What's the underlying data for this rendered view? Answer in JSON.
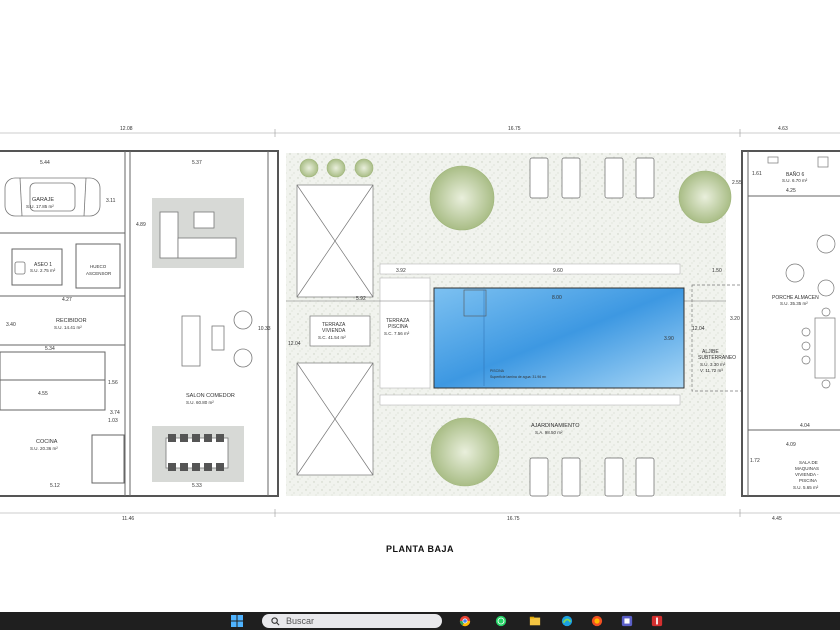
{
  "plan": {
    "title": "PLANTA BAJA",
    "dims_top": [
      "12.08",
      "16.75",
      "4.63"
    ],
    "dims_bottom": [
      "11.46",
      "16.75",
      "4.45"
    ],
    "rooms": {
      "garaje": {
        "name": "GARAJE",
        "area": "S.U. 17.85 m²"
      },
      "aseo": {
        "name": "ASEO 1",
        "area": "S.U. 2.75 m²"
      },
      "ascensor": {
        "name": "HUECO",
        "name2": "ASCENSOR"
      },
      "recibidor": {
        "name": "RECIBIDOR",
        "area": "S.U. 14.41 m²"
      },
      "salon": {
        "name": "SALON COMEDOR",
        "area": "S.U. 60.80 m²"
      },
      "cocina": {
        "name": "COCINA",
        "area": "S.U. 20.36 m²"
      },
      "terraza_vivienda": {
        "name": "TERRAZA",
        "name2": "VIVIENDA",
        "area": "S.C. 41.54 m²"
      },
      "terraza_piscina": {
        "name": "TERRAZA",
        "name2": "PISCINA",
        "area": "S.C. 7.56 m²"
      },
      "piscina": {
        "name": "PISCINA",
        "area": "Superficie lamina de agua: 31.96 m²"
      },
      "aljibe": {
        "name": "ALJIBE",
        "name2": "SUBTERRANEO",
        "area": "S.U. 3.30 m²",
        "area2": "V: 11.72 m³"
      },
      "ajardinamiento": {
        "name": "AJARDINAMIENTO",
        "area": "S.A. 98.50 m²"
      },
      "bano": {
        "name": "BAÑO 6",
        "area": "S.U. 6.70 m²"
      },
      "porche": {
        "name": "PORCHE ALMACEN",
        "area": "S.U. 35.35 m²"
      },
      "maquinas": {
        "name": "SALA DE",
        "name2": "MAQUINAS",
        "name3": "VIVIENDA -",
        "name4": "PISCINA",
        "area": "S.U. 5.65 m²"
      }
    },
    "dims_inner": {
      "garaje_w": "5.44",
      "garaje_h": "3.11",
      "recibidor_w": "4.27",
      "recibidor_h": "3.40",
      "cocina_top": "5.34",
      "cocina_w": "4.55",
      "cocina_bottom": "5.12",
      "cocina_side": "3.74",
      "cocina_v1": "1.56",
      "cocina_v2": "1.03",
      "salon_top": "5.37",
      "salon_side": "4.89",
      "salon_mid": "10.33",
      "salon_bottom": "5.33",
      "pool_left": "3.92",
      "pool_w": "9.60",
      "pool_right": "1.50",
      "pool_mid_left": "5.92",
      "pool_inner_w": "8.00",
      "pool_h": "3.90",
      "terraza_h": "12.04",
      "aljibe_v": "12.04",
      "aljibe_h": "3.20",
      "bano_h": "2.55",
      "bano_v": "1.61",
      "bano_w": "4.25",
      "porche_w": "4.04",
      "maq_v": "1.72",
      "maq_w": "4.09"
    }
  },
  "taskbar": {
    "search_placeholder": "Buscar",
    "icons": [
      "windows-icon",
      "search-icon",
      "chrome-icon",
      "whatsapp-icon",
      "files-icon",
      "browser-icon",
      "app-icon",
      "app-icon-2",
      "red-app-icon"
    ]
  },
  "colors": {
    "wall": "#555555",
    "pool": "#4a9ee0",
    "garden": "#eef1ea",
    "tree": "#b7c79a",
    "taskbar": "#1f1f1f"
  }
}
